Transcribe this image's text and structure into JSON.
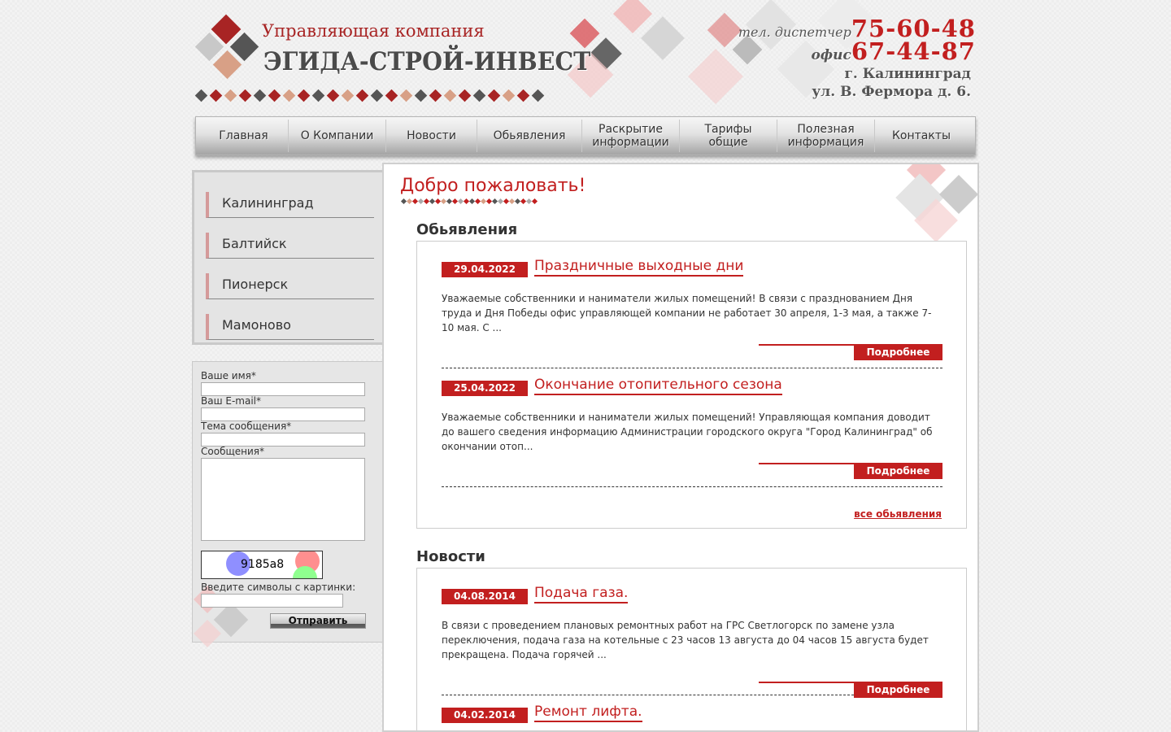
{
  "header": {
    "subtitle": "Управляющая компания",
    "company": "ЭГИДА-СТРОЙ-ИНВЕСТ",
    "dispatcher_label": "тел. диспетчер",
    "dispatcher_phone": "75-60-48",
    "office_label": "офис",
    "office_phone": "67-44-87",
    "city": "г. Калининград",
    "address": "ул. В. Фермора д. 6."
  },
  "nav": {
    "items": [
      {
        "label": "Главная"
      },
      {
        "label": "О Компании"
      },
      {
        "label": "Новости"
      },
      {
        "label": "Обьявления"
      },
      {
        "label": "Раскрытие информации"
      },
      {
        "label": "Тарифы общие"
      },
      {
        "label": "Полезная информация"
      },
      {
        "label": "Контакты"
      }
    ]
  },
  "sidebar": {
    "cities": [
      "Калининград",
      "Балтийск",
      "Пионерск",
      "Мамоново"
    ]
  },
  "form": {
    "name_label": "Ваше имя*",
    "email_label": "Ваш E-mail*",
    "subject_label": "Тема сообщения*",
    "message_label": "Сообщения*",
    "captcha_code": "9185a8",
    "captcha_label": "Введите символы с картинки:",
    "submit_label": "Отправить"
  },
  "main": {
    "welcome": "Добро пожаловать!",
    "announcements": {
      "title": "Обьявления",
      "items": [
        {
          "date": "29.04.2022",
          "title": "Праздничные выходные дни",
          "text": "Уважаемые собственники и наниматели жилых помещений!   В связи с празднованием Дня труда и Дня Победы офис управляющей компании не работает 30 апреля, 1-3 мая, а также 7-10 мая. С ...",
          "more": "Подробнее"
        },
        {
          "date": "25.04.2022",
          "title": "Окончание отопительного сезона",
          "text": "Уважаемые собственники и наниматели жилых помещений!  Управляющая компания доводит до вашего сведения информацию Администрации городского округа \"Город Калининград\" об окончании отоп...",
          "more": "Подробнее"
        }
      ],
      "all_link": "все обьявления"
    },
    "news": {
      "title": "Новости",
      "items": [
        {
          "date": "04.08.2014",
          "title": "Подача газа.",
          "text": "В связи с проведением плановых ремонтных работ на ГРС Светлогорск по замене узла переключения, подача газа на котельные с 23 часов 13 августа до 04 часов 15 августа будет прекращена. Подача горячей ...",
          "more": "Подробнее"
        },
        {
          "date": "04.02.2014",
          "title": "Ремонт лифта."
        }
      ]
    }
  },
  "colors": {
    "accent_red": "#c21f1f",
    "dark_gray": "#555555",
    "light_pink": "#d9a08a"
  }
}
